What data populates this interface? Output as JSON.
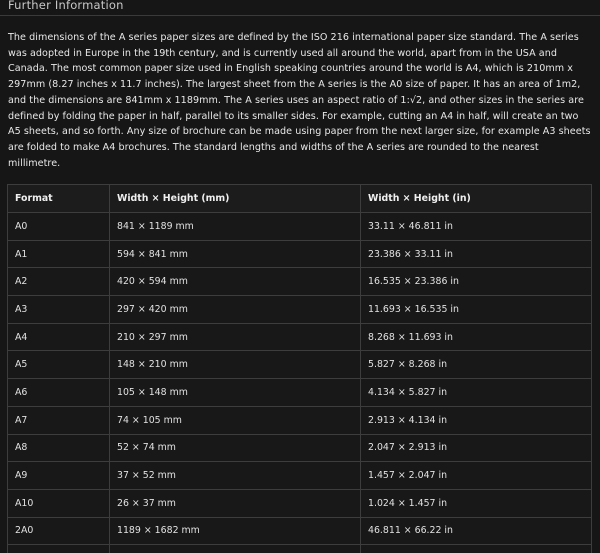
{
  "section": {
    "heading": "Further Information",
    "paragraph": "The dimensions of the A series paper sizes are defined by the ISO 216 international paper size standard. The A series was adopted in Europe in the 19th century, and is currently used all around the world, apart from in the USA and Canada. The most common paper size used in English speaking countries around the world is A4, which is 210mm x 297mm (8.27 inches x 11.7 inches). The largest sheet from the A series is the A0 size of paper. It has an area of 1m2, and the dimensions are 841mm x 1189mm. The A series uses an aspect ratio of 1:√2, and other sizes in the series are defined by folding the paper in half, parallel to its smaller sides. For example, cutting an A4 in half, will create an two A5 sheets, and so forth. Any size of brochure can be made using paper from the next larger size, for example A3 sheets are folded to make A4 brochures. The standard lengths and widths of the A series are rounded to the nearest millimetre."
  },
  "table": {
    "headers": [
      "Format",
      "Width × Height (mm)",
      "Width × Height (in)"
    ],
    "rows": [
      [
        "A0",
        "841 × 1189 mm",
        "33.11 × 46.811 in"
      ],
      [
        "A1",
        "594 × 841 mm",
        "23.386 × 33.11 in"
      ],
      [
        "A2",
        "420 × 594 mm",
        "16.535 × 23.386 in"
      ],
      [
        "A3",
        "297 × 420 mm",
        "11.693 × 16.535 in"
      ],
      [
        "A4",
        "210 × 297 mm",
        "8.268 × 11.693 in"
      ],
      [
        "A5",
        "148 × 210 mm",
        "5.827 × 8.268 in"
      ],
      [
        "A6",
        "105 × 148 mm",
        "4.134 × 5.827 in"
      ],
      [
        "A7",
        "74 × 105 mm",
        "2.913 × 4.134 in"
      ],
      [
        "A8",
        "52 × 74 mm",
        "2.047 × 2.913 in"
      ],
      [
        "A9",
        "37 × 52 mm",
        "1.457 × 2.047 in"
      ],
      [
        "A10",
        "26 × 37 mm",
        "1.024 × 1.457 in"
      ],
      [
        "2A0",
        "1189 × 1682 mm",
        "46.811 × 66.22 in"
      ],
      [
        "",
        "",
        ""
      ]
    ]
  }
}
